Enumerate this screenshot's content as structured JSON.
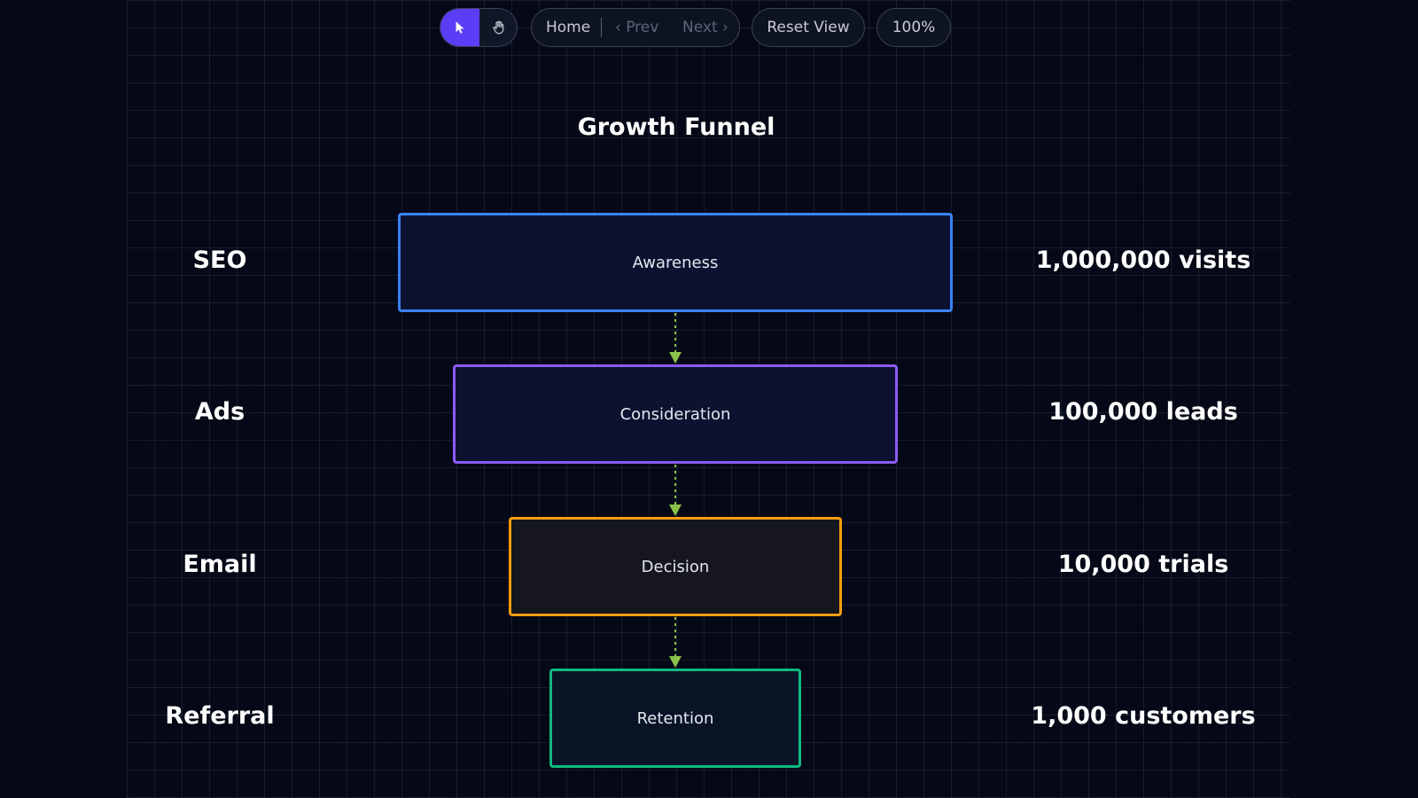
{
  "toolbar": {
    "select_tool": "select-pointer",
    "hand_tool": "hand-pan",
    "home_label": "Home",
    "prev_label": "‹ Prev",
    "next_label": "Next ›",
    "reset_label": "Reset View",
    "zoom_label": "100%"
  },
  "diagram": {
    "title": "Growth Funnel",
    "stages": [
      {
        "label": "Awareness",
        "channel": "SEO",
        "metric": "1,000,000 visits",
        "color": "#3b82f6"
      },
      {
        "label": "Consideration",
        "channel": "Ads",
        "metric": "100,000 leads",
        "color": "#8b5cf6"
      },
      {
        "label": "Decision",
        "channel": "Email",
        "metric": "10,000 trials",
        "color": "#f59e0b"
      },
      {
        "label": "Retention",
        "channel": "Referral",
        "metric": "1,000 customers",
        "color": "#10b981"
      }
    ],
    "edge_color": "#8bc34a"
  }
}
